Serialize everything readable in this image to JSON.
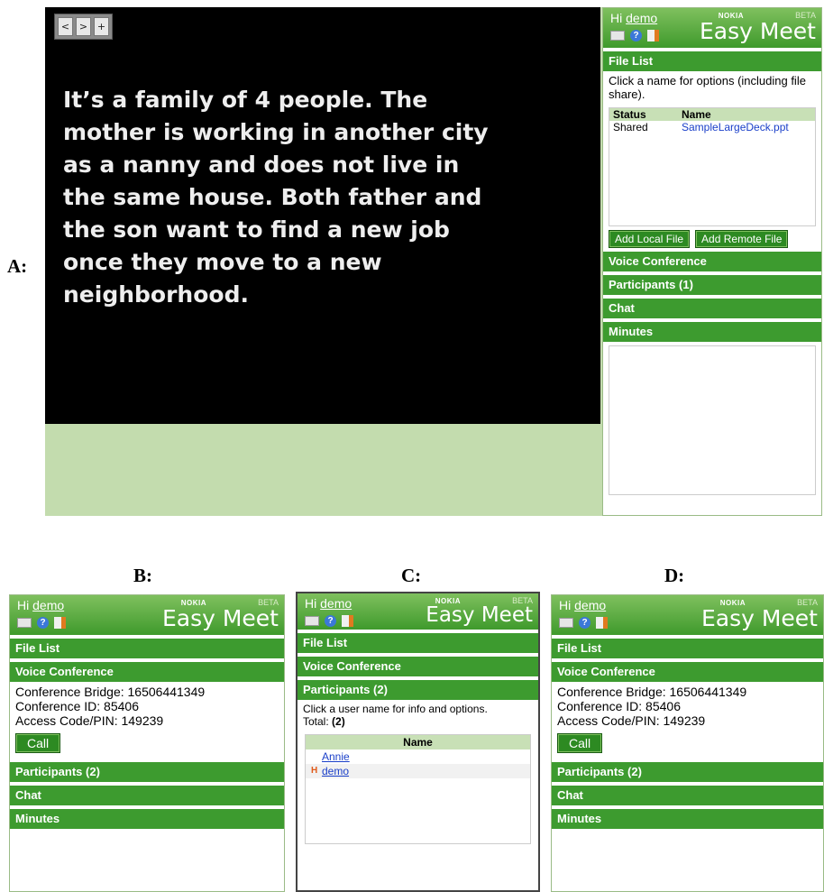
{
  "labels": {
    "a": "A:",
    "b": "B:",
    "c": "C:",
    "d": "D:"
  },
  "slide": {
    "nav": [
      "<",
      ">",
      "+"
    ],
    "text": "It’s a family of 4 people. The mother is working in another city as a nanny and does not live in the same house. Both father and the son want to find a new job once they move to a new neighborhood."
  },
  "app": {
    "greeting": "Hi",
    "user": "demo",
    "vendor": "NOKIA",
    "beta": "BETA",
    "brand": "Easy Meet"
  },
  "panel_a": {
    "file_list": "File List",
    "instructions": "Click a name for options (including file share).",
    "columns": [
      "Status",
      "Name"
    ],
    "files": [
      {
        "status": "Shared",
        "name": "SampleLargeDeck.ppt"
      }
    ],
    "add_local": "Add Local File",
    "add_remote": "Add Remote File",
    "voice": "Voice Conference",
    "participants": "Participants (1)",
    "chat": "Chat",
    "minutes": "Minutes"
  },
  "panel_bd": {
    "file_list": "File List",
    "voice": "Voice Conference",
    "bridge": "Conference Bridge: 16506441349",
    "conf_id": "Conference ID: 85406",
    "pin": "Access Code/PIN: 149239",
    "call": "Call",
    "participants": "Participants (2)",
    "chat": "Chat",
    "minutes": "Minutes"
  },
  "panel_c": {
    "file_list": "File List",
    "voice": "Voice Conference",
    "participants": "Participants (2)",
    "instructions": "Click a user name for info and options.",
    "total_label": "Total:",
    "total": "(2)",
    "name_header": "Name",
    "users": [
      {
        "name": "Annie",
        "mod": ""
      },
      {
        "name": "demo",
        "mod": "H"
      }
    ]
  }
}
